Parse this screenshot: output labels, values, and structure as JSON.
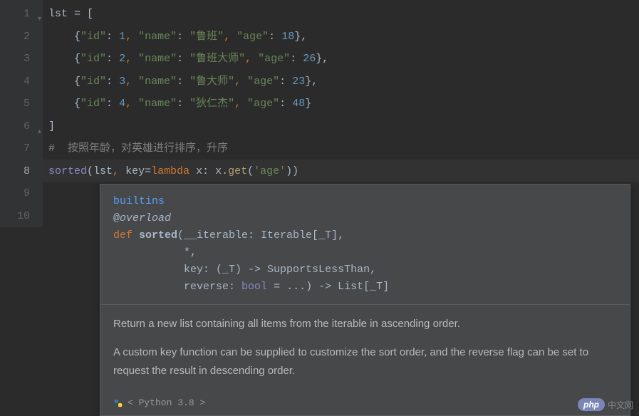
{
  "gutter": {
    "lines": [
      "1",
      "2",
      "3",
      "4",
      "5",
      "6",
      "7",
      "8",
      "9",
      "10"
    ],
    "active_index": 7
  },
  "code": {
    "l1": {
      "var": "lst",
      "eq": " = ["
    },
    "l2": {
      "indent": "    ",
      "open": "{",
      "k1": "\"id\"",
      "c1": ": ",
      "v1": "1",
      "s1": ", ",
      "k2": "\"name\"",
      "c2": ": ",
      "v2": "\"鲁班\"",
      "s2": ", ",
      "k3": "\"age\"",
      "c3": ": ",
      "v3": "18",
      "close": "},"
    },
    "l3": {
      "indent": "    ",
      "open": "{",
      "k1": "\"id\"",
      "c1": ": ",
      "v1": "2",
      "s1": ", ",
      "k2": "\"name\"",
      "c2": ": ",
      "v2": "\"鲁班大师\"",
      "s2": ", ",
      "k3": "\"age\"",
      "c3": ": ",
      "v3": "26",
      "close": "},"
    },
    "l4": {
      "indent": "    ",
      "open": "{",
      "k1": "\"id\"",
      "c1": ": ",
      "v1": "3",
      "s1": ", ",
      "k2": "\"name\"",
      "c2": ": ",
      "v2": "\"鲁大师\"",
      "s2": ", ",
      "k3": "\"age\"",
      "c3": ": ",
      "v3": "23",
      "close": "},"
    },
    "l5": {
      "indent": "    ",
      "open": "{",
      "k1": "\"id\"",
      "c1": ": ",
      "v1": "4",
      "s1": ", ",
      "k2": "\"name\"",
      "c2": ": ",
      "v2": "\"狄仁杰\"",
      "s2": ", ",
      "k3": "\"age\"",
      "c3": ": ",
      "v3": "48",
      "close": "}"
    },
    "l6": {
      "text": "]"
    },
    "l7": {
      "comment": "#  按照年龄，对英雄进行排序，升序"
    },
    "l8": {
      "fn": "sorted",
      "open": "(",
      "arg1": "lst",
      "s": ", ",
      "kw": "key",
      "eq": "=",
      "lam": "lambda",
      "lamrest": " x: x.",
      "get": "get",
      "getopen": "(",
      "getarg": "'age'",
      "close": "))"
    }
  },
  "popup": {
    "source": "builtins",
    "deco_at": "@",
    "deco": "overload",
    "def": "def ",
    "fn": "sorted",
    "sig_l1": "(__iterable: Iterable[_T],",
    "sig_l2": "*,",
    "sig_l3": "key: (_T) -> SupportsLessThan,",
    "sig_l4_pre": "reverse: ",
    "sig_l4_type": "bool",
    "sig_l4_post": " = ...) -> List[_T]",
    "desc1": "Return a new list containing all items from the iterable in ascending order.",
    "desc2": "A custom key function can be supplied to customize the sort order, and the reverse flag can be set to request the result in descending order.",
    "footer": "< Python 3.8 >"
  },
  "watermark": {
    "badge": "php",
    "text": "中文网"
  }
}
